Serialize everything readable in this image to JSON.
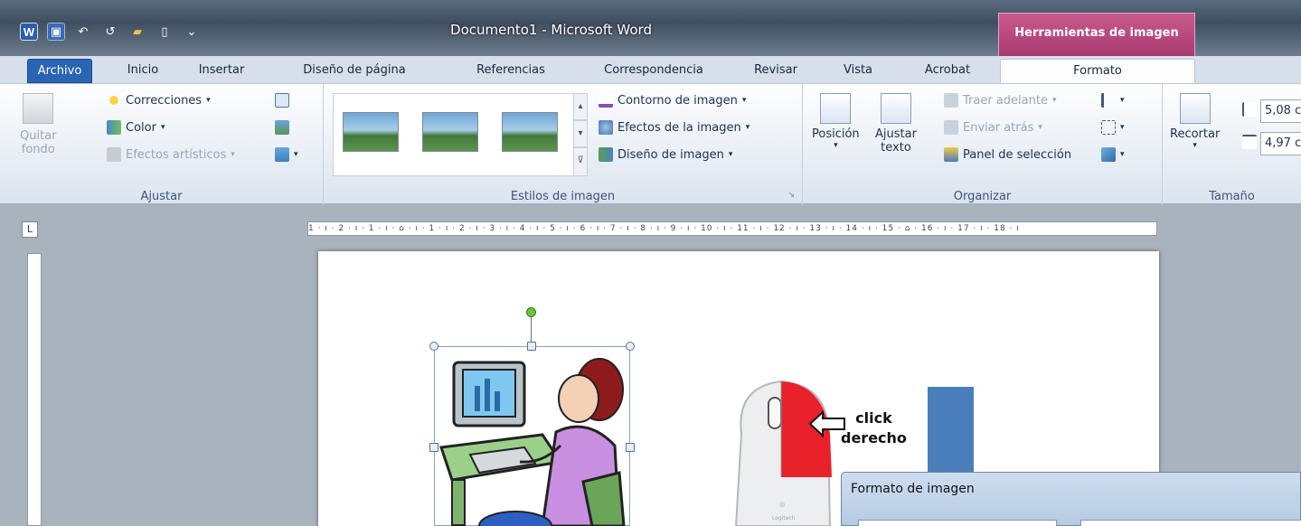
{
  "window": {
    "title": "Documento1 - Microsoft Word",
    "context_tab": "Herramientas de imagen"
  },
  "tabs": [
    "Archivo",
    "Inicio",
    "Insertar",
    "Diseño de página",
    "Referencias",
    "Correspondencia",
    "Revisar",
    "Vista",
    "Acrobat",
    "Formato"
  ],
  "active_tab": "Formato",
  "ribbon": {
    "ajustar": {
      "label": "Ajustar",
      "quitar_fondo": "Quitar\nfondo",
      "correcciones": "Correcciones",
      "color": "Color",
      "efectos_artisticos": "Efectos artísticos"
    },
    "estilos": {
      "label": "Estilos de imagen",
      "contorno": "Contorno de imagen",
      "efectos": "Efectos de la imagen",
      "diseno": "Diseño de imagen"
    },
    "organizar": {
      "label": "Organizar",
      "posicion": "Posición",
      "ajustar_texto": "Ajustar\ntexto",
      "traer_adelante": "Traer adelante",
      "enviar_atras": "Enviar atrás",
      "panel_seleccion": "Panel de selección"
    },
    "tamano": {
      "label": "Tamaño",
      "recortar": "Recortar",
      "alto": "5,08 c",
      "ancho": "4,97 c"
    }
  },
  "ruler": {
    "text": "1 · ı · 2 · ı · 1 · ı · ⌂ · ı · 1 · ı · 2 · ı · 3 · ı · 4 · ı · 5 · ı · 6 · ı · 7 · ı · 8 · ı · 9 · ı · 10 · ı · 11 · ı · 12 · ı · 13 · ı · 14 · ı · 15 · ⌂ · 16 · ı · 17 · ı · 18 · ı"
  },
  "annotation": {
    "line1": "click",
    "line2": "derecho"
  },
  "mouse_brand": "Logitech",
  "dialog": {
    "title": "Formato de imagen"
  },
  "colors": {
    "title_bg": "#4a5a6c",
    "context_tab": "#b8457d",
    "file_tab": "#2a65b4",
    "chart_bar": "#4a7ebb",
    "mouse_highlight": "#e8212b"
  }
}
